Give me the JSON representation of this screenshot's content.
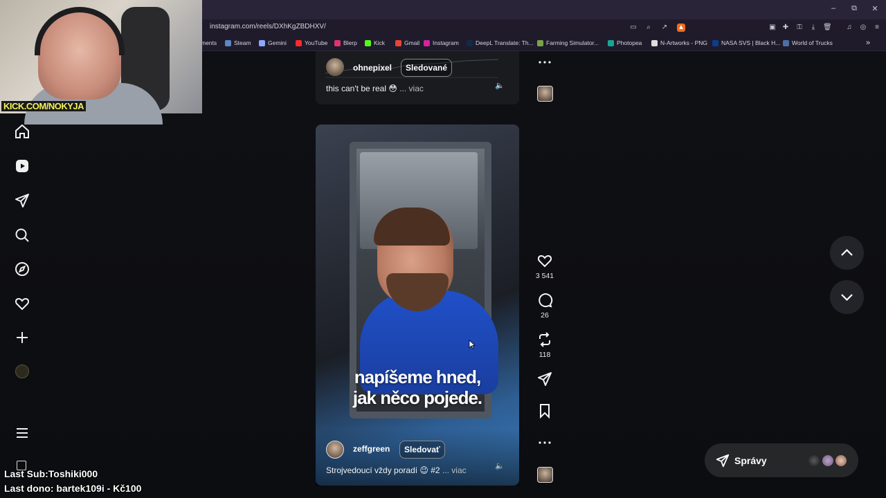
{
  "browser": {
    "url": "instagram.com/reels/DXhKgZBDHXV/",
    "window_buttons": {
      "minimize": "–",
      "restore": "⧉",
      "close": "✕"
    },
    "bookmarks": [
      {
        "label": "ments",
        "color": "#8a8a8a"
      },
      {
        "label": "Steam",
        "color": "#5b88c8"
      },
      {
        "label": "Gemini",
        "color": "#8aa8ff"
      },
      {
        "label": "YouTube",
        "color": "#ff2b2b"
      },
      {
        "label": "Blerp",
        "color": "#e0336b"
      },
      {
        "label": "Kick",
        "color": "#53fc18"
      },
      {
        "label": "Gmail",
        "color": "#ea4335"
      },
      {
        "label": "Instagram",
        "color": "#d6249f"
      },
      {
        "label": "DeepL Translate: Th...",
        "color": "#0f2b46"
      },
      {
        "label": "Farming Simulator...",
        "color": "#7aa348"
      },
      {
        "label": "Photopea",
        "color": "#18a497"
      },
      {
        "label": "N-Artworks - PNG",
        "color": "#dddddd"
      },
      {
        "label": "NASA SVS | Black H...",
        "color": "#0b3d91"
      },
      {
        "label": "World of Trucks",
        "color": "#4a6fa5"
      }
    ],
    "bookmarks_more": "»"
  },
  "webcam": {
    "tag": "KICK.COM/NOKYJA"
  },
  "sidebar": {
    "items": [
      {
        "name": "home-icon"
      },
      {
        "name": "reels-icon"
      },
      {
        "name": "direct-icon"
      },
      {
        "name": "search-icon"
      },
      {
        "name": "explore-icon"
      },
      {
        "name": "notifications-icon"
      },
      {
        "name": "create-icon"
      },
      {
        "name": "profile-avatar"
      }
    ],
    "more": "menu-icon"
  },
  "reel_previous": {
    "username": "ohnepixel",
    "follow_label": "Sledované",
    "caption": "this can't be real 😳",
    "more_label": "... viac"
  },
  "reel_current": {
    "username": "zeffgreen",
    "follow_label": "Sledovať",
    "overlay_line1": "napíšeme hned,",
    "overlay_line2": "jak něco pojede.",
    "caption": "Strojvedoucí vždy poradí 😉 #2",
    "more_label": "... viac",
    "likes": "3 541",
    "comments": "26",
    "reposts": "118"
  },
  "messages": {
    "label": "Správy"
  },
  "stream_overlay": {
    "last_sub": "Last Sub:Toshiki000",
    "last_dono": "Last dono: bartek109i - Kč100"
  },
  "colors": {
    "accent_blue": "#2050c8",
    "background": "#0c0d11",
    "chrome": "#2a2438"
  }
}
